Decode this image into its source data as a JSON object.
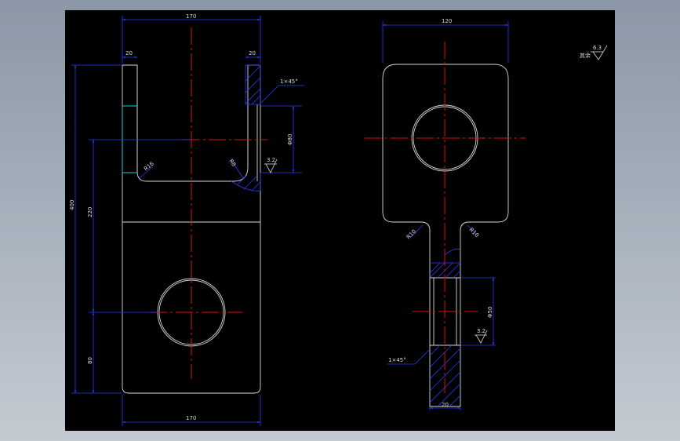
{
  "drawing": {
    "background": "#000000",
    "outline_color": "#d8d8d8",
    "centerline_color": "#e01010",
    "dimension_color": "#2a3cff",
    "hidden_edge_color": "#22d0d0"
  },
  "front_view": {
    "dim_top_width": "170",
    "dim_left_prong": "20",
    "dim_right_prong": "20",
    "dim_chamfer": "1×45°",
    "dim_bore": "Φ80",
    "dim_radius_left": "R16",
    "dim_radius_right": "R8",
    "roughness": "3.2",
    "dim_overall_height": "400",
    "dim_center_distance": "220",
    "dim_lower_height": "80",
    "dim_bottom_width": "170"
  },
  "side_view": {
    "dim_top_width": "120",
    "dim_radius_left": "R10",
    "dim_radius_right": "R10",
    "dim_bore": "Φ50",
    "roughness": "3.2",
    "dim_chamfer": "1×45°",
    "dim_stem_width": "20"
  },
  "general_roughness": {
    "label": "其余",
    "value": "6.3"
  }
}
